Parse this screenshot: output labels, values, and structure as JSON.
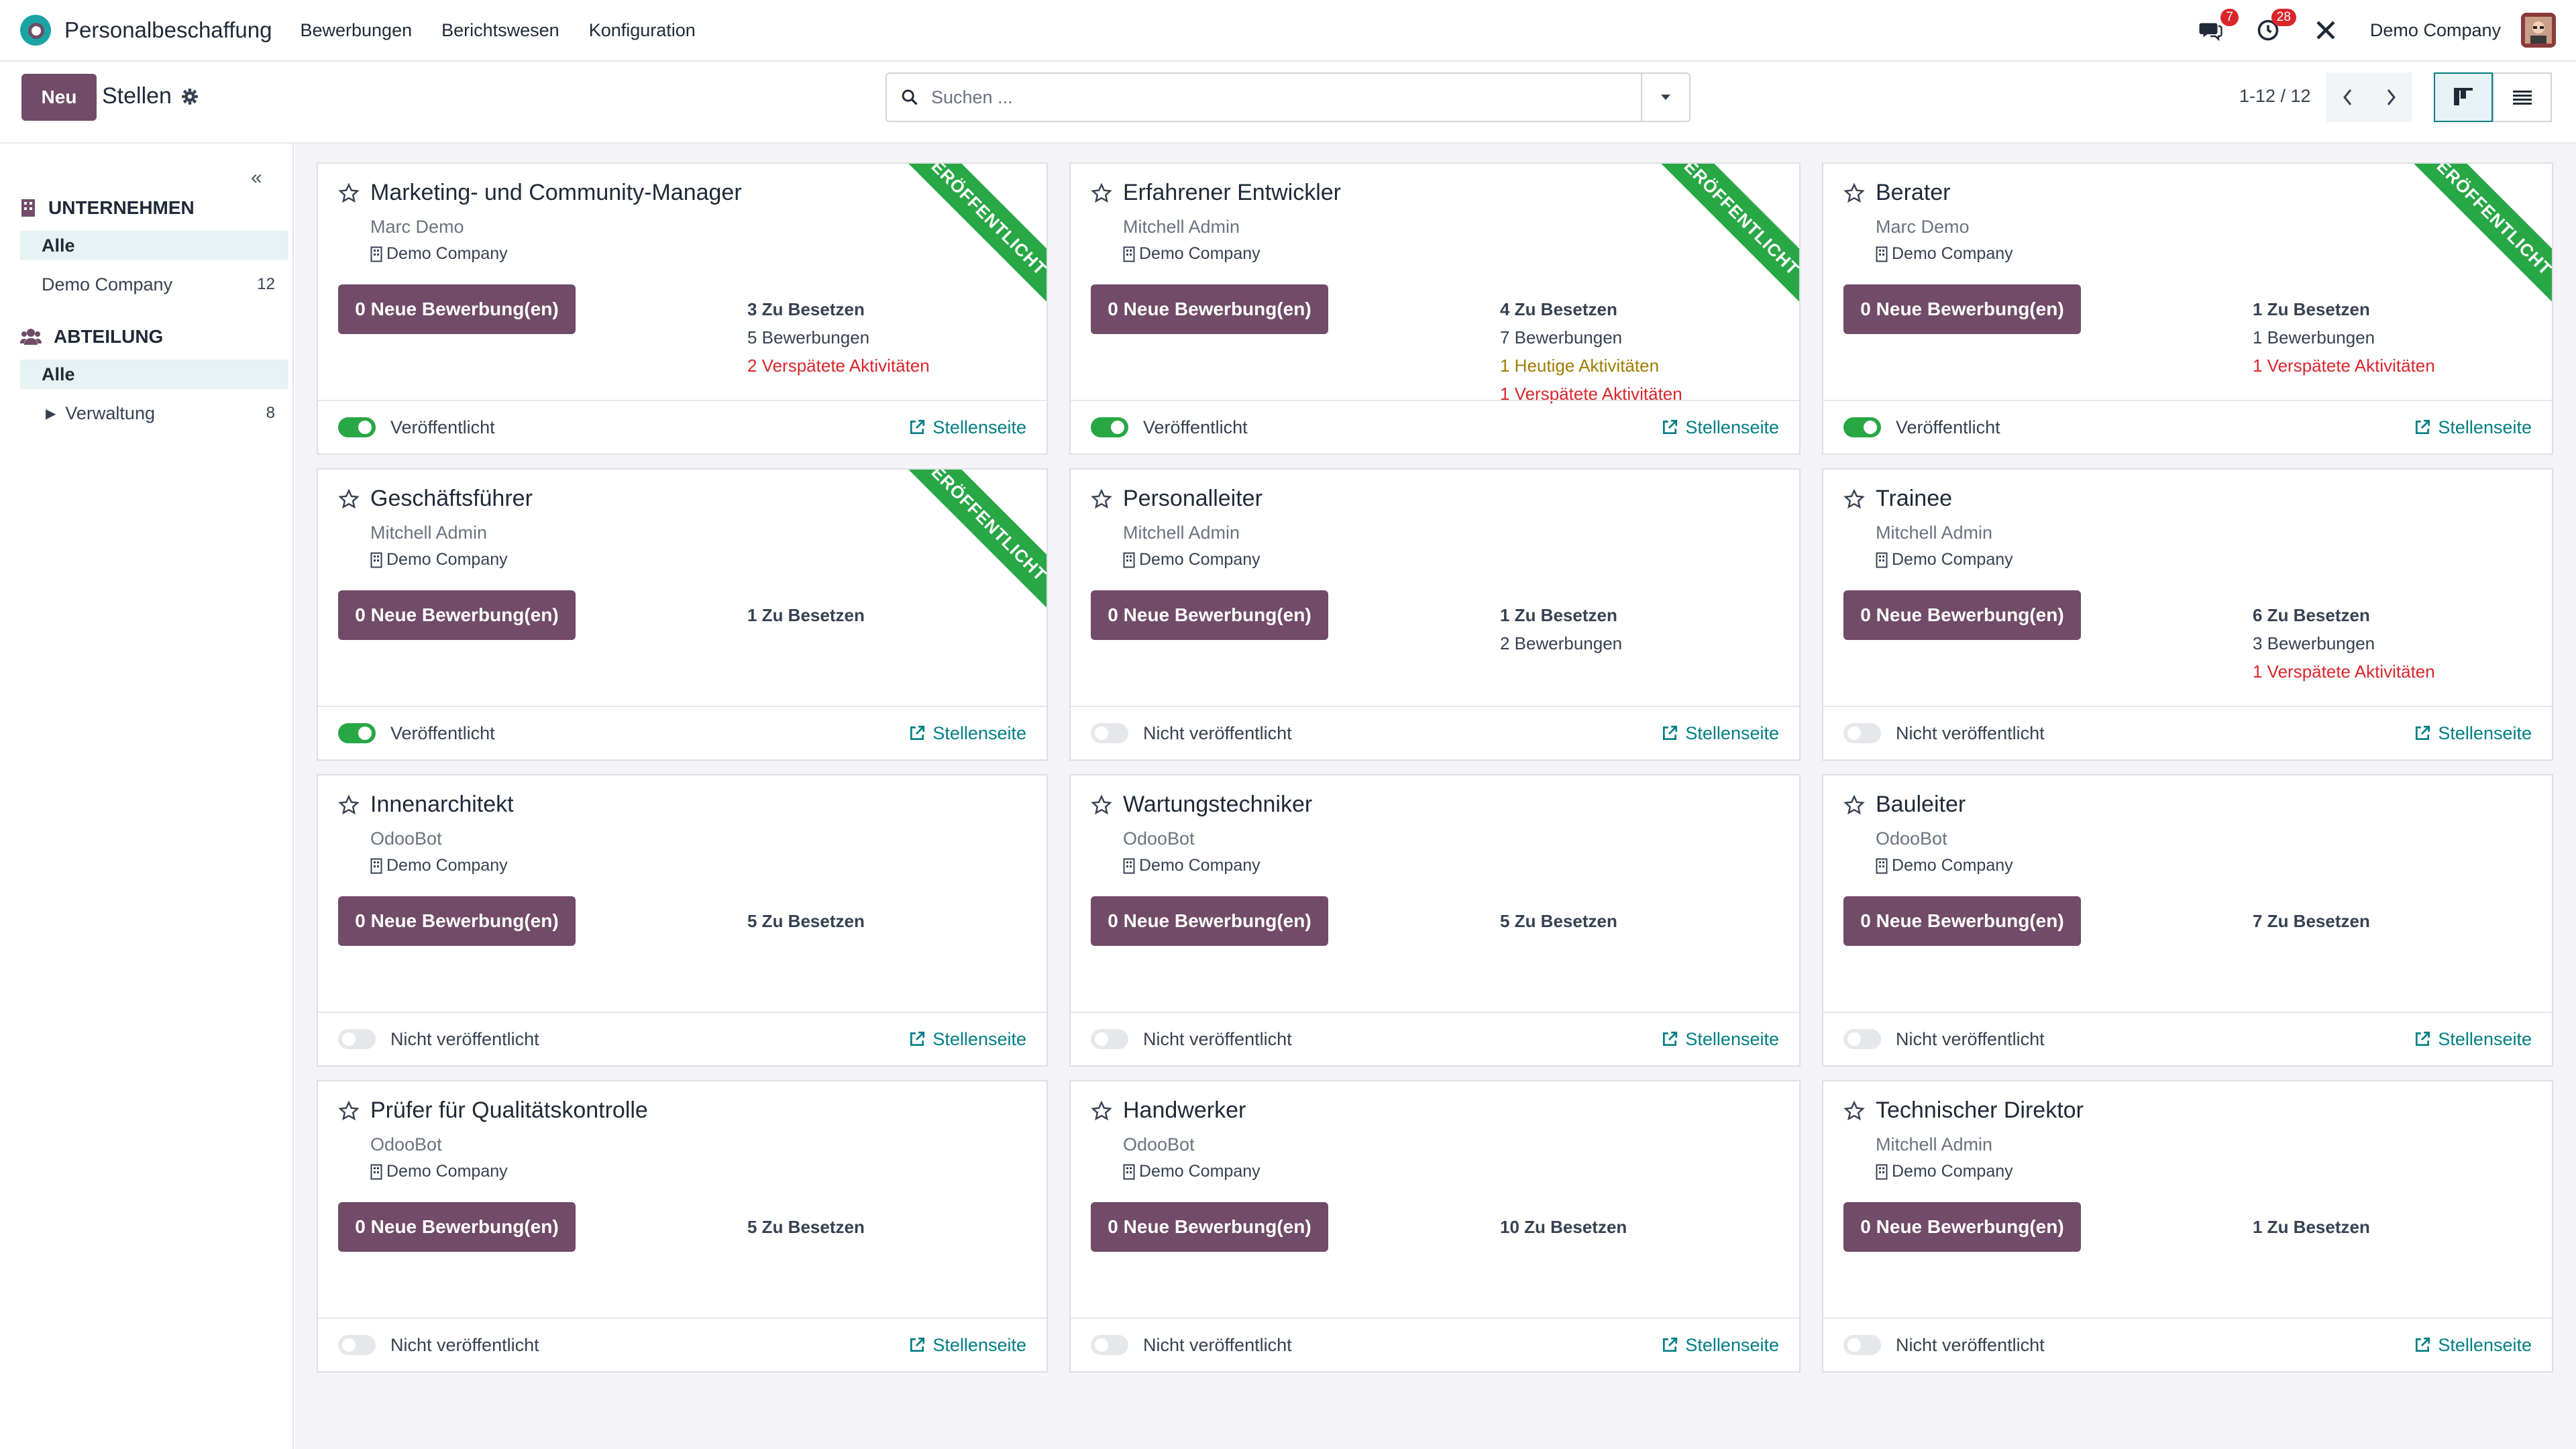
{
  "navbar": {
    "app_title": "Personalbeschaffung",
    "menus": [
      "Bewerbungen",
      "Berichtswesen",
      "Konfiguration"
    ],
    "messages_badge": "7",
    "activities_badge": "28",
    "company": "Demo Company",
    "icons": [
      "messages-icon",
      "activities-icon",
      "debug-tools-icon",
      "user-avatar"
    ]
  },
  "control": {
    "new_label": "Neu",
    "title": "Stellen",
    "search_placeholder": "Suchen ...",
    "pager": "1-12 / 12"
  },
  "sidebar": {
    "sections": [
      {
        "title": "UNTERNEHMEN",
        "icon": "building-icon",
        "items": [
          {
            "label": "Alle",
            "count": "",
            "active": true
          },
          {
            "label": "Demo Company",
            "count": "12",
            "active": false
          }
        ]
      },
      {
        "title": "ABTEILUNG",
        "icon": "users-icon",
        "items": [
          {
            "label": "Alle",
            "count": "",
            "active": true
          },
          {
            "label": "Verwaltung",
            "count": "8",
            "active": false,
            "expandable": true
          }
        ]
      }
    ]
  },
  "cards": [
    {
      "title": "Marketing- und Community-Manager",
      "user": "Marc Demo",
      "company": "Demo Company",
      "applications": "0 Neue Bewerbung(en)",
      "stats": [
        {
          "text": "3 Zu Besetzen",
          "kind": "bold"
        },
        {
          "text": "5 Bewerbungen",
          "kind": "normal"
        },
        {
          "text": "2 Verspätete Aktivitäten",
          "kind": "danger"
        }
      ],
      "published": true,
      "publish_label": "Veröffentlicht",
      "ribbon": "VERÖFFENTLICHT",
      "link": "Stellenseite"
    },
    {
      "title": "Erfahrener Entwickler",
      "user": "Mitchell Admin",
      "company": "Demo Company",
      "applications": "0 Neue Bewerbung(en)",
      "stats": [
        {
          "text": "4 Zu Besetzen",
          "kind": "bold"
        },
        {
          "text": "7 Bewerbungen",
          "kind": "normal"
        },
        {
          "text": "1 Heutige Aktivitäten",
          "kind": "warning"
        },
        {
          "text": "1 Verspätete Aktivitäten",
          "kind": "danger"
        }
      ],
      "published": true,
      "publish_label": "Veröffentlicht",
      "ribbon": "VERÖFFENTLICHT",
      "link": "Stellenseite"
    },
    {
      "title": "Berater",
      "user": "Marc Demo",
      "company": "Demo Company",
      "applications": "0 Neue Bewerbung(en)",
      "stats": [
        {
          "text": "1 Zu Besetzen",
          "kind": "bold"
        },
        {
          "text": "1 Bewerbungen",
          "kind": "normal"
        },
        {
          "text": "1 Verspätete Aktivitäten",
          "kind": "danger"
        }
      ],
      "published": true,
      "publish_label": "Veröffentlicht",
      "ribbon": "VERÖFFENTLICHT",
      "link": "Stellenseite"
    },
    {
      "title": "Geschäftsführer",
      "user": "Mitchell Admin",
      "company": "Demo Company",
      "applications": "0 Neue Bewerbung(en)",
      "stats": [
        {
          "text": "1 Zu Besetzen",
          "kind": "bold"
        }
      ],
      "published": true,
      "publish_label": "Veröffentlicht",
      "ribbon": "VERÖFFENTLICHT",
      "link": "Stellenseite"
    },
    {
      "title": "Personalleiter",
      "user": "Mitchell Admin",
      "company": "Demo Company",
      "applications": "0 Neue Bewerbung(en)",
      "stats": [
        {
          "text": "1 Zu Besetzen",
          "kind": "bold"
        },
        {
          "text": "2 Bewerbungen",
          "kind": "normal"
        }
      ],
      "published": false,
      "publish_label": "Nicht veröffentlicht",
      "ribbon": "",
      "link": "Stellenseite"
    },
    {
      "title": "Trainee",
      "user": "Mitchell Admin",
      "company": "Demo Company",
      "applications": "0 Neue Bewerbung(en)",
      "stats": [
        {
          "text": "6 Zu Besetzen",
          "kind": "bold"
        },
        {
          "text": "3 Bewerbungen",
          "kind": "normal"
        },
        {
          "text": "1 Verspätete Aktivitäten",
          "kind": "danger"
        }
      ],
      "published": false,
      "publish_label": "Nicht veröffentlicht",
      "ribbon": "",
      "link": "Stellenseite"
    },
    {
      "title": "Innenarchitekt",
      "user": "OdooBot",
      "company": "Demo Company",
      "applications": "0 Neue Bewerbung(en)",
      "stats": [
        {
          "text": "5 Zu Besetzen",
          "kind": "bold"
        }
      ],
      "published": false,
      "publish_label": "Nicht veröffentlicht",
      "ribbon": "",
      "link": "Stellenseite"
    },
    {
      "title": "Wartungstechniker",
      "user": "OdooBot",
      "company": "Demo Company",
      "applications": "0 Neue Bewerbung(en)",
      "stats": [
        {
          "text": "5 Zu Besetzen",
          "kind": "bold"
        }
      ],
      "published": false,
      "publish_label": "Nicht veröffentlicht",
      "ribbon": "",
      "link": "Stellenseite"
    },
    {
      "title": "Bauleiter",
      "user": "OdooBot",
      "company": "Demo Company",
      "applications": "0 Neue Bewerbung(en)",
      "stats": [
        {
          "text": "7 Zu Besetzen",
          "kind": "bold"
        }
      ],
      "published": false,
      "publish_label": "Nicht veröffentlicht",
      "ribbon": "",
      "link": "Stellenseite"
    },
    {
      "title": "Prüfer für Qualitätskontrolle",
      "user": "OdooBot",
      "company": "Demo Company",
      "applications": "0 Neue Bewerbung(en)",
      "stats": [
        {
          "text": "5 Zu Besetzen",
          "kind": "bold"
        }
      ],
      "published": false,
      "publish_label": "Nicht veröffentlicht",
      "ribbon": "",
      "link": "Stellenseite"
    },
    {
      "title": "Handwerker",
      "user": "OdooBot",
      "company": "Demo Company",
      "applications": "0 Neue Bewerbung(en)",
      "stats": [
        {
          "text": "10 Zu Besetzen",
          "kind": "bold"
        }
      ],
      "published": false,
      "publish_label": "Nicht veröffentlicht",
      "ribbon": "",
      "link": "Stellenseite"
    },
    {
      "title": "Technischer Direktor",
      "user": "Mitchell Admin",
      "company": "Demo Company",
      "applications": "0 Neue Bewerbung(en)",
      "stats": [
        {
          "text": "1 Zu Besetzen",
          "kind": "bold"
        }
      ],
      "published": false,
      "publish_label": "Nicht veröffentlicht",
      "ribbon": "",
      "link": "Stellenseite"
    }
  ],
  "colors": {
    "primary": "#714b67",
    "accent": "#017e84",
    "published": "#28a745",
    "danger": "#d9262c",
    "warning": "#a07c00"
  }
}
